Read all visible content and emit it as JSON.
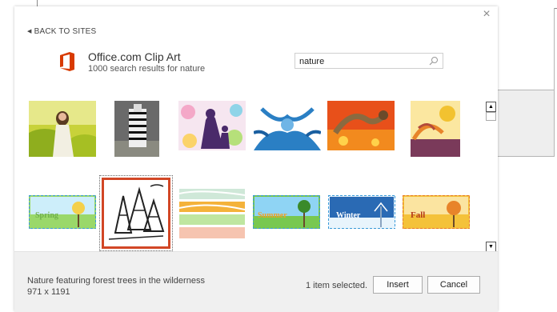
{
  "dialog": {
    "close_glyph": "×",
    "back_link": "BACK TO SITES",
    "source": {
      "title": "Office.com Clip Art",
      "results": "1000 search results for nature",
      "logo_icon": "office-logo-icon",
      "brand_color": "#d83b01"
    },
    "search": {
      "value": "nature",
      "icon": "search-icon"
    },
    "thumbnails": [
      {
        "name": "thumb-woman-in-field"
      },
      {
        "name": "thumb-zebra"
      },
      {
        "name": "thumb-silhouette-mother-child"
      },
      {
        "name": "thumb-blue-swirls"
      },
      {
        "name": "thumb-orange-dragon"
      },
      {
        "name": "thumb-autumn-swirl"
      },
      {
        "name": "thumb-spring-banner",
        "label": "Spring"
      },
      {
        "name": "thumb-forest-trees",
        "selected": true
      },
      {
        "name": "thumb-banners-stack"
      },
      {
        "name": "thumb-summer-banner",
        "label": "Summer"
      },
      {
        "name": "thumb-winter-banner",
        "label": "Winter"
      },
      {
        "name": "thumb-fall-banner",
        "label": "Fall"
      }
    ],
    "scrollbar": {
      "up_glyph": "▲",
      "down_glyph": "▼"
    },
    "footer": {
      "description": "Nature featuring forest trees in the wilderness",
      "dimensions": "971 x 1191",
      "selection_status": "1 item selected.",
      "insert_label": "Insert",
      "cancel_label": "Cancel"
    },
    "colors": {
      "accent": "#d24726",
      "footer_bg": "#f0f0f0"
    }
  }
}
